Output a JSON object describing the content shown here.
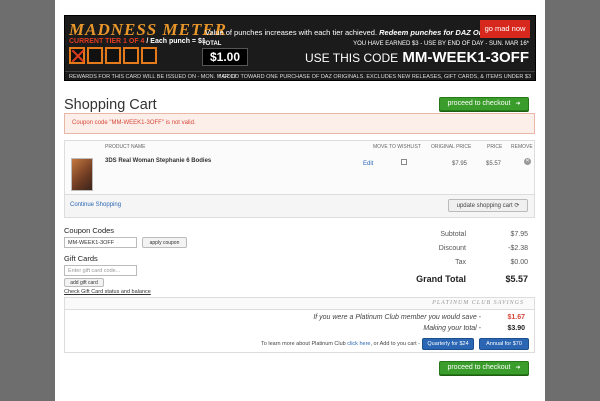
{
  "banner": {
    "logo": "MADNESS METER",
    "tier_label": "CURRENT TIER 1 OF 4",
    "punch_label": "/ Each punch = $1",
    "message_plain": "Value of punches increases with each tier achieved.",
    "message_bold": "Redeem punches for DAZ Originals!",
    "go_button": "go mad now",
    "total_label": "TOTAL",
    "total_value": "$1.00",
    "earned_text": "YOU HAVE EARNED $3 - USE BY END OF DAY - SUN. MAR 16*",
    "use_code_prefix": "USE THIS CODE",
    "use_code": "MM-WEEK1-3OFF",
    "footer_left": "REWARDS FOR THIS CARD WILL BE ISSUED ON - MON. MAR 17",
    "footer_right": "* GOOD TOWARD ONE PURCHASE OF DAZ ORIGINALS. EXCLUDES NEW RELEASES, GIFT CARDS, & ITEMS UNDER $3",
    "punches_used": 1,
    "punches_total": 5
  },
  "page_title": "Shopping Cart",
  "checkout_label": "proceed to checkout",
  "alert": "Coupon code \"MM-WEEK1-3OFF\" is not valid.",
  "cart": {
    "headers": {
      "product": "PRODUCT NAME",
      "wishlist": "MOVE TO WISHLIST",
      "original": "ORIGINAL PRICE",
      "price": "PRICE",
      "remove": "REMOVE"
    },
    "item": {
      "name": "3DS Real Woman Stephanie 6 Bodies",
      "edit": "Edit",
      "original_price": "$7.95",
      "price": "$5.57"
    },
    "continue": "Continue Shopping",
    "update": "update shopping cart"
  },
  "coupon": {
    "label": "Coupon Codes",
    "value": "MM-WEEK1-3OFF",
    "apply": "apply coupon"
  },
  "gift": {
    "label": "Gift Cards",
    "placeholder": "Enter gift card code...",
    "add": "add gift card",
    "check_link": "Check Gift Card status and balance"
  },
  "totals": {
    "subtotal_label": "Subtotal",
    "subtotal": "$7.95",
    "discount_label": "Discount",
    "discount": "-$2.38",
    "tax_label": "Tax",
    "tax": "$0.00",
    "grand_label": "Grand Total",
    "grand": "$5.57"
  },
  "platinum": {
    "header": "PLATINUM CLUB SAVINGS",
    "save_label": "If you were a Platinum Club member you would save -",
    "save_value": "$1.67",
    "total_label": "Making your total -",
    "total_value": "$3.90",
    "learn_prefix": "To learn more about Platinum Club",
    "learn_link": "click here",
    "learn_suffix": ", or Add to you cart -",
    "quarterly": "Quarterly for $24",
    "annual": "Annual for $70"
  },
  "colors": {
    "accent_green": "#3a9c2a",
    "alert_red": "#d6473a",
    "link_blue": "#2a66b3"
  }
}
